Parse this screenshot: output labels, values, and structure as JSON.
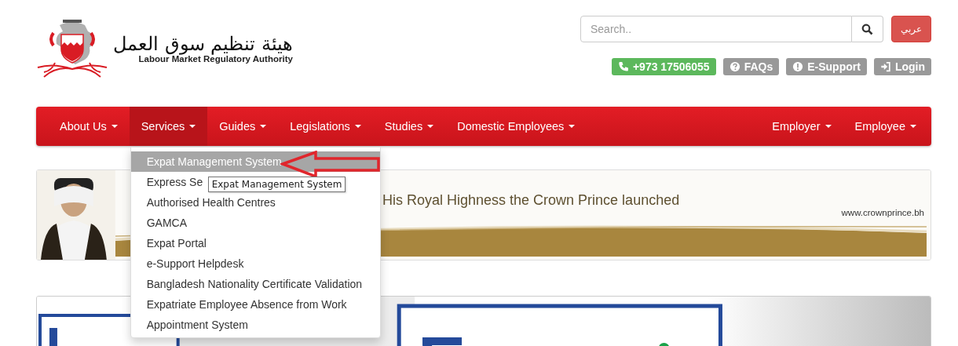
{
  "header": {
    "logo": {
      "arabic": "هيئة تنظيم سوق العمل",
      "english": "Labour Market Regulatory Authority"
    },
    "search": {
      "placeholder": "Search.."
    },
    "language_button": "عربي",
    "contact_buttons": [
      {
        "kind": "phone",
        "label": "+973 17506055"
      },
      {
        "kind": "faq",
        "label": "FAQs"
      },
      {
        "kind": "support",
        "label": "E-Support"
      },
      {
        "kind": "login",
        "label": "Login"
      }
    ]
  },
  "nav": {
    "left": [
      {
        "label": "About Us",
        "selected": false
      },
      {
        "label": "Services",
        "selected": true
      },
      {
        "label": "Guides",
        "selected": false
      },
      {
        "label": "Legislations",
        "selected": false
      },
      {
        "label": "Studies",
        "selected": false
      },
      {
        "label": "Domestic Employees",
        "selected": false
      }
    ],
    "right": [
      {
        "label": "Employer",
        "selected": false
      },
      {
        "label": "Employee",
        "selected": false
      }
    ]
  },
  "dropdown": {
    "items": [
      {
        "label": "Expat Management System",
        "selected": true
      },
      {
        "label": "Express Se",
        "selected": false
      },
      {
        "label": "Authorised Health Centres",
        "selected": false
      },
      {
        "label": "GAMCA",
        "selected": false
      },
      {
        "label": "Expat Portal",
        "selected": false
      },
      {
        "label": "e-Support Helpdesk",
        "selected": false
      },
      {
        "label": "Bangladesh Nationality Certificate Validation",
        "selected": false
      },
      {
        "label": "Expatriate Employee Absence from Work",
        "selected": false
      },
      {
        "label": "Appointment System",
        "selected": false
      }
    ],
    "tooltip": "Expat Management System"
  },
  "banner": {
    "headline": "His Royal Highness the Crown Prince launched",
    "url": "www.crownprince.bh"
  }
}
